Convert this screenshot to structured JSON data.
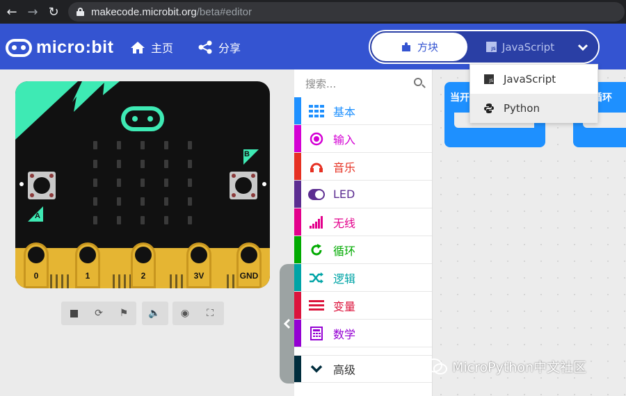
{
  "browser": {
    "url_host": "makecode.microbit.org",
    "url_path": "/beta#editor"
  },
  "header": {
    "logo_text": "micro:bit",
    "home_label": "主页",
    "share_label": "分享",
    "toggle_blocks_label": "方块",
    "toggle_js_label": "JavaScript",
    "brand_color": "#3454d1"
  },
  "dropdown": {
    "items": [
      {
        "label": "JavaScript",
        "icon": "javascript-icon"
      },
      {
        "label": "Python",
        "icon": "python-icon"
      }
    ]
  },
  "simulator": {
    "pins": [
      "0",
      "1",
      "2",
      "3V",
      "GND"
    ],
    "button_a": "A",
    "button_b": "B",
    "controls": [
      "stop-icon",
      "restart-icon",
      "slow-mo-icon",
      "sound-icon",
      "screenshot-icon",
      "fullscreen-icon"
    ]
  },
  "toolbox": {
    "search_placeholder": "搜索...",
    "categories": [
      {
        "label": "基本",
        "color": "#1e90ff"
      },
      {
        "label": "输入",
        "color": "#d400d4"
      },
      {
        "label": "音乐",
        "color": "#e63022"
      },
      {
        "label": "LED",
        "color": "#5c2d91"
      },
      {
        "label": "无线",
        "color": "#e3008c"
      },
      {
        "label": "循环",
        "color": "#00aa00"
      },
      {
        "label": "逻辑",
        "color": "#00a4a6"
      },
      {
        "label": "变量",
        "color": "#dc143c"
      },
      {
        "label": "数学",
        "color": "#9400d3"
      }
    ],
    "advanced_label": "高级"
  },
  "workspace": {
    "block1_label": "当开",
    "block2_label": "循环"
  },
  "watermark": "MicroPython中文社区"
}
